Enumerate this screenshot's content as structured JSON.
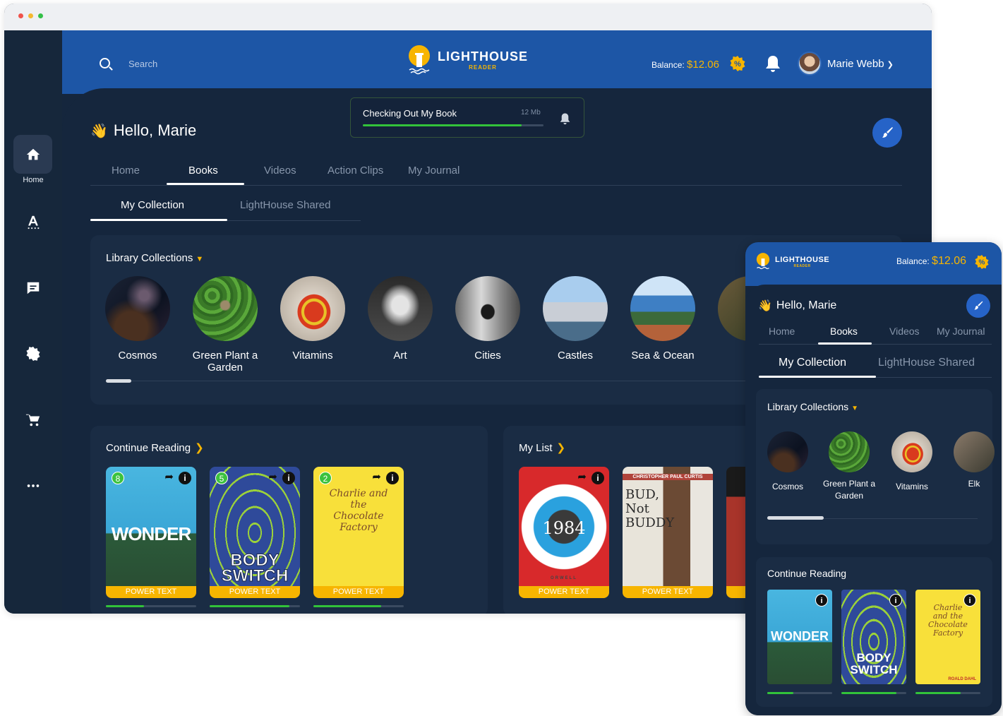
{
  "header": {
    "search_placeholder": "Search",
    "logo_title": "LIGHTHOUSE",
    "logo_subtitle": "READER",
    "balance_label": "Balance:",
    "balance_amount": "$12.06",
    "user_name": "Marie Webb"
  },
  "sidebar": {
    "home_label": "Home",
    "icons": [
      "home-icon",
      "text-format-icon",
      "chat-icon",
      "settings-icon",
      "cart-icon",
      "more-icon"
    ]
  },
  "download": {
    "title": "Checking Out My Book",
    "size": "12 Mb",
    "progress": 0.88
  },
  "greeting": "Hello, Marie",
  "tabs": [
    {
      "label": "Home"
    },
    {
      "label": "Books"
    },
    {
      "label": "Videos"
    },
    {
      "label": "Action Clips"
    },
    {
      "label": "My Journal"
    }
  ],
  "subtabs": [
    {
      "label": "My Collection"
    },
    {
      "label": "LightHouse Shared"
    }
  ],
  "library": {
    "title": "Library Collections",
    "items": [
      {
        "label": "Cosmos"
      },
      {
        "label": "Green Plant a Garden"
      },
      {
        "label": "Vitamins"
      },
      {
        "label": "Art"
      },
      {
        "label": "Cities"
      },
      {
        "label": "Castles"
      },
      {
        "label": "Sea & Ocean"
      }
    ]
  },
  "continue_reading": {
    "title": "Continue Reading",
    "books": [
      {
        "title": "WONDER",
        "badge": "8",
        "tag": "POWER TEXT",
        "progress": 0.42
      },
      {
        "title": "BODY SWITCH",
        "badge": "5",
        "tag": "POWER TEXT",
        "progress": 0.88
      },
      {
        "title": "Charlie and the Chocolate Factory",
        "badge": "2",
        "tag": "POWER TEXT",
        "progress": 0.75
      }
    ]
  },
  "my_list": {
    "title": "My List",
    "books": [
      {
        "title": "1984",
        "tag": "POWER TEXT",
        "author": "ORWELL"
      },
      {
        "title": "BUD, Not BUDDY",
        "tag": "POWER TEXT",
        "author": "CHRISTOPHER PAUL CURTIS"
      }
    ]
  },
  "mobile": {
    "logo_title": "LIGHTHOUSE",
    "logo_subtitle": "READER",
    "balance_label": "Balance:",
    "balance_amount": "$12.06",
    "greeting": "Hello, Marie",
    "tabs": [
      {
        "label": "Home"
      },
      {
        "label": "Books"
      },
      {
        "label": "Videos"
      },
      {
        "label": "My Journal"
      }
    ],
    "subtabs": [
      {
        "label": "My Collection"
      },
      {
        "label": "LightHouse Shared"
      }
    ],
    "library_title": "Library Collections",
    "library_items": [
      {
        "label": "Cosmos"
      },
      {
        "label": "Green Plant a Garden"
      },
      {
        "label": "Vitamins"
      },
      {
        "label": "Elk"
      }
    ],
    "continue_reading_title": "Continue Reading",
    "books": [
      {
        "title": "WONDER",
        "progress": 0.4
      },
      {
        "title": "BODY SWITCH",
        "progress": 0.85
      },
      {
        "title": "Charlie and the Chocolate Factory",
        "author": "ROALD DAHL",
        "progress": 0.7
      }
    ]
  },
  "colors": {
    "brand_blue": "#1d56a6",
    "background": "#15263d",
    "card": "#1a2c44",
    "accent_yellow": "#f7b500",
    "progress_green": "#32c23a"
  }
}
